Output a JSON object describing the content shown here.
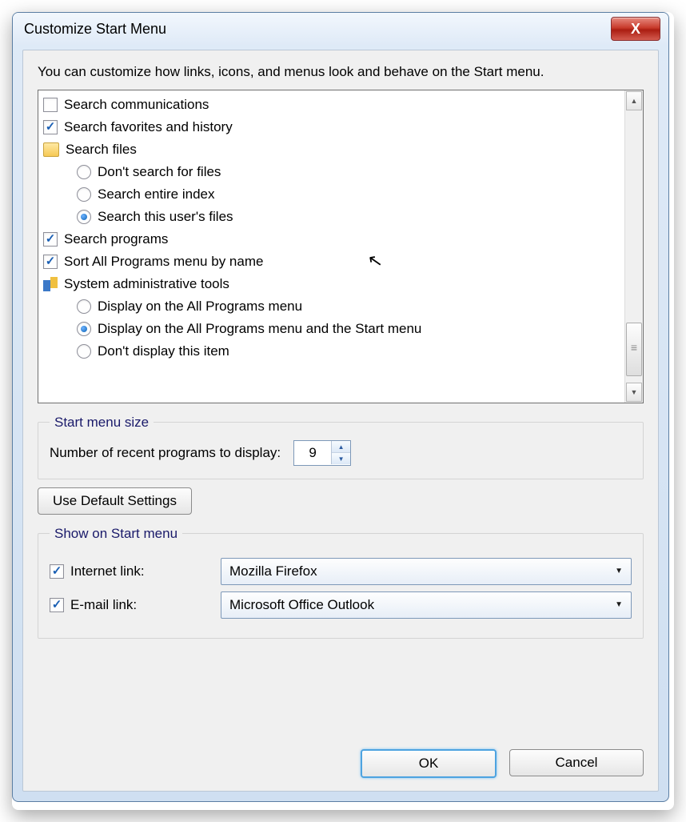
{
  "title": "Customize Start Menu",
  "close_glyph": "X",
  "intro": "You can customize how links, icons, and menus look and behave on the Start menu.",
  "list": {
    "search_comm": "Search communications",
    "search_fav": "Search favorites and history",
    "search_files": "Search files",
    "sf_opt1": "Don't search for files",
    "sf_opt2": "Search entire index",
    "sf_opt3": "Search this user's files",
    "search_prog": "Search programs",
    "sort_all": "Sort All Programs menu by name",
    "admin": "System administrative tools",
    "adm_opt1": "Display on the All Programs menu",
    "adm_opt2": "Display on the All Programs menu and the Start menu",
    "adm_opt3": "Don't display this item"
  },
  "size": {
    "legend": "Start menu size",
    "label": "Number of recent programs to display:",
    "value": "9"
  },
  "defaults_btn": "Use Default Settings",
  "show": {
    "legend": "Show on Start menu",
    "internet_label": "Internet link:",
    "internet_value": "Mozilla Firefox",
    "email_label": "E-mail link:",
    "email_value": "Microsoft Office Outlook"
  },
  "ok": "OK",
  "cancel": "Cancel"
}
